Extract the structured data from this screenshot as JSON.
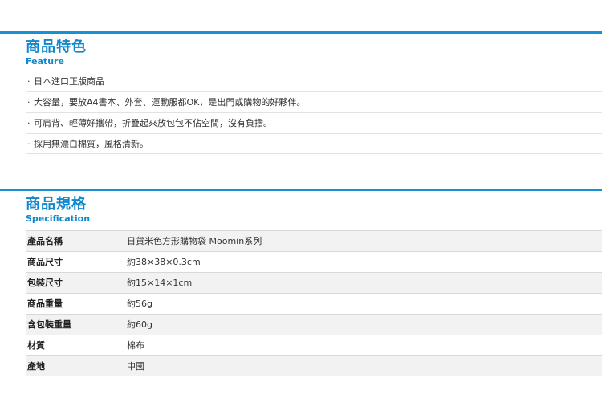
{
  "feature": {
    "title": "商品特色",
    "subtitle": "Feature",
    "items": [
      "日本進口正版商品",
      "大容量，要放A4書本、外套、運動服都OK，是出門或購物的好夥伴。",
      "可肩背、輕薄好攜帶，折疊起來放包包不佔空間，沒有負擔。",
      "採用無漂白棉質，風格清新。"
    ],
    "bullet": "‧"
  },
  "spec": {
    "title": "商品規格",
    "subtitle": "Specification",
    "rows": [
      {
        "label": "產品名稱",
        "value": "日貨米色方形購物袋 Moomin系列"
      },
      {
        "label": "商品尺寸",
        "value": "約38×38×0.3cm"
      },
      {
        "label": "包裝尺寸",
        "value": "約15×14×1cm"
      },
      {
        "label": "商品重量",
        "value": "約56g"
      },
      {
        "label": "含包裝重量",
        "value": "約60g"
      },
      {
        "label": "材質",
        "value": "棉布"
      },
      {
        "label": "產地",
        "value": "中國"
      }
    ]
  },
  "colors": {
    "accent": "#1592d6",
    "title": "#1187cc",
    "row_shade": "#f2f2f2"
  }
}
